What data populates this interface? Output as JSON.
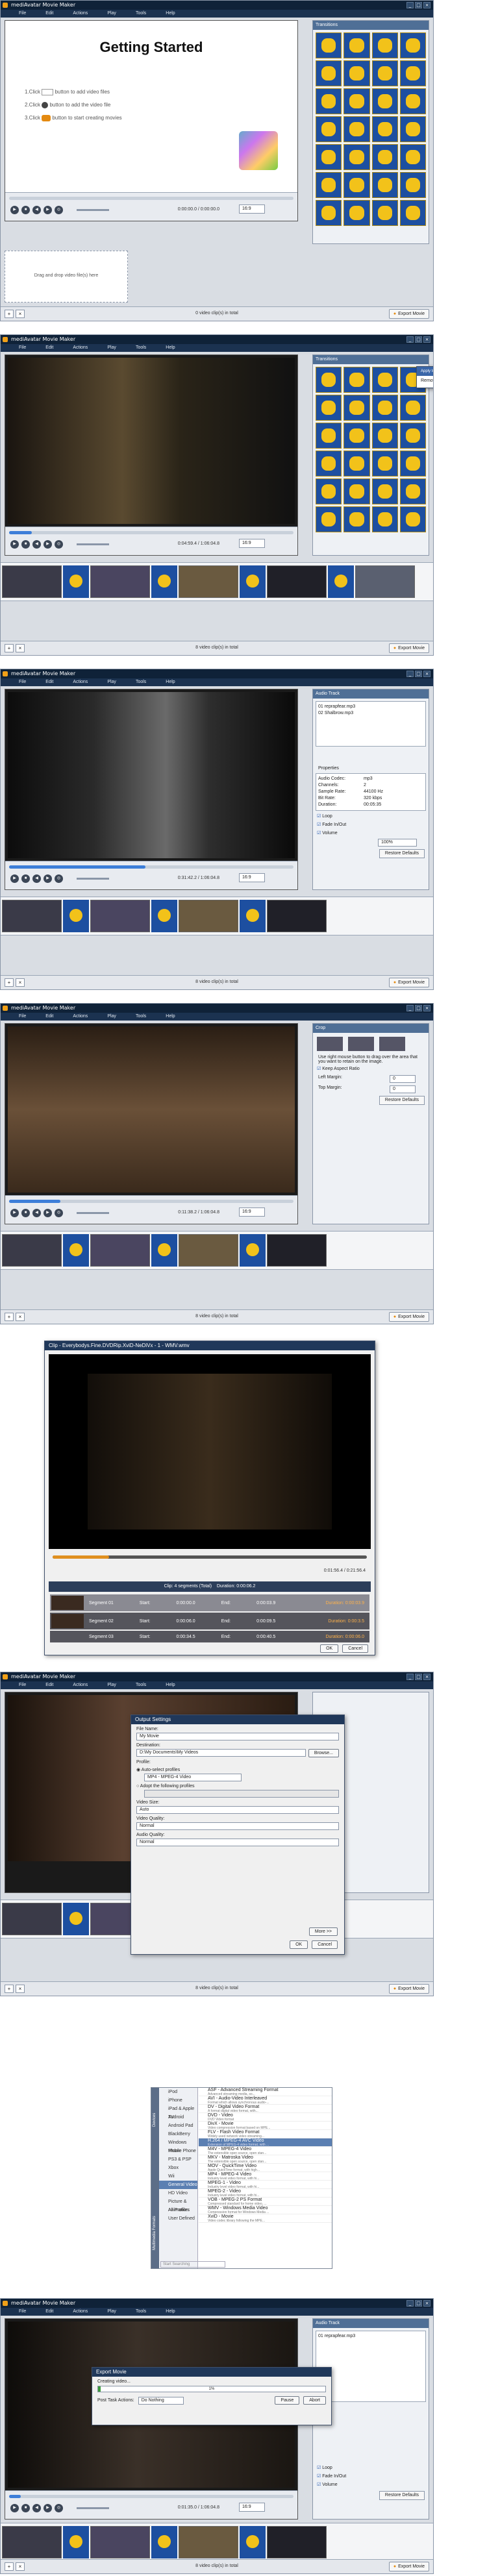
{
  "app": {
    "title": "mediAvatar Movie Maker",
    "menu": [
      "File",
      "Edit",
      "Actions",
      "Play",
      "Tools",
      "Help"
    ]
  },
  "shot1": {
    "heading": "Getting Started",
    "steps": [
      "1.Click",
      "button to add video files",
      "2.Click",
      "button to add the video file",
      "3.Click",
      "button to start creating movies"
    ],
    "dropzone": "Drag and drop video file(s) here",
    "time": "0:00:00.0 / 0:00:00.0",
    "ratio": "16:9",
    "panel_title": "Transitions",
    "status": "0 video clip(s) in total",
    "export": "Export Movie"
  },
  "shot2": {
    "time": "0:04:59.4 / 1:06:04.8",
    "ratio": "16:9",
    "panel_title": "Transitions",
    "ctx_menu": [
      "Apply to Multiple Video Clip(s)",
      "Remove all transitions"
    ],
    "status": "8 video clip(s) in total",
    "export": "Export Movie",
    "seek": 0.08
  },
  "shot3": {
    "panel_title": "Audio Track",
    "tracks": [
      "01 reprapfear.mp3",
      "02 Shalbrow.mp3"
    ],
    "props_title": "Properties",
    "props": [
      [
        "Audio Codec:",
        "mp3"
      ],
      [
        "Channels:",
        "2"
      ],
      [
        "Sample Rate:",
        "44100 Hz"
      ],
      [
        "Bit Rate:",
        "320 kbps"
      ],
      [
        "Duration:",
        "00:05:35"
      ]
    ],
    "checks": [
      "Loop",
      "Fade In/Out",
      "Volume"
    ],
    "volume": "100%",
    "restore": "Restore Defaults",
    "time": "0:31:42.2 / 1:06:04.8",
    "ratio": "16:9",
    "status": "8 video clip(s) in total",
    "export": "Export Movie",
    "seek": 0.48
  },
  "shot4": {
    "panel_title": "Crop",
    "hint": "Use right mouse button to drag over the area that you want to retain on the image.",
    "keep": "Keep Aspect Ratio",
    "left_margin": "Left Margin:",
    "left_val": "0",
    "top_margin": "Top Margin:",
    "top_val": "0",
    "restore": "Restore Defaults",
    "time": "0:11:38.2 / 1:06:04.8",
    "ratio": "16:9",
    "status": "8 video clip(s) in total",
    "export": "Export Movie",
    "seek": 0.18
  },
  "shot5": {
    "title": "Clip - Everybodys.Fine.DVDRip.XviD-NeDiVx - 1 - WMV.wmv",
    "time": "0:01:56.4 / 0:21:56.4",
    "clips_info": "Clip: 4 segments (Total)",
    "duration": "Duration: 0:00:06.2",
    "segments": [
      {
        "name": "Segment 01",
        "start": "0:00:00.0",
        "end": "0:00:03.9",
        "dur": "Duration: 0:00:03.9"
      },
      {
        "name": "Segment 02",
        "start": "0:00:06.0",
        "end": "0:00:09.5",
        "dur": "Duration: 0:00:3.5"
      },
      {
        "name": "Segment 03",
        "start": "0:00:34.5",
        "end": "0:00:40.5",
        "dur": "Duration: 0:00:06.0"
      }
    ],
    "start_label": "Start:",
    "end_label": "End:",
    "ok": "OK",
    "cancel": "Cancel"
  },
  "shot6": {
    "dialog_title": "Output Settings",
    "file_name_label": "File Name:",
    "file_name": "My Movie",
    "dest_label": "Destination:",
    "dest": "D:\\My Documents\\My Videos",
    "browse": "Browse...",
    "profile_label": "Profile:",
    "auto_profile": "Auto-select profiles",
    "auto_value": "MP4 - MPEG-4 Video",
    "adopt": "Adopt the following profiles",
    "video_size_label": "Video Size:",
    "video_size": "Auto",
    "video_quality_label": "Video Quality:",
    "video_quality": "Normal",
    "audio_quality_label": "Audio Quality:",
    "audio_quality": "Normal",
    "more": "More >>",
    "ok": "OK",
    "cancel": "Cancel",
    "status": "8 video clip(s) in total",
    "export": "Export Movie"
  },
  "shot7": {
    "side_labels": [
      "Devices",
      "Multimedia Formats"
    ],
    "categories": [
      "iPod",
      "iPhone",
      "iPad & Apple TV",
      "Android",
      "Android Pad",
      "BlackBerry",
      "Windows Phone",
      "Mobile Phone",
      "PS3 & PSP",
      "Xbox",
      "Wii",
      "General Video Formats",
      "HD Video",
      "Picture & Animation",
      "All Profiles",
      "User Defined"
    ],
    "cat_selected": 11,
    "formats": [
      [
        "ASF - Advanced Streaming Format",
        "Advanced streaming media, so..."
      ],
      [
        "AVI - Audio-Video Interleaved",
        "Format which allows synchronous audio-..."
      ],
      [
        "DV - Digital Video Format",
        "A format digital video format, with..."
      ],
      [
        "DVD - Video",
        "DVD Video format"
      ],
      [
        "DivX - Movie",
        "Video compression format based on MPE..."
      ],
      [
        "FLV - Flash Video Format",
        "Widely used network video streaming..."
      ],
      [
        "H.264 / MPEG-4 AVC Video",
        "Extension of MPEG-4 video format, with ..."
      ],
      [
        "M4V - MPEG-4 Video",
        "The extensible open source, open stan..."
      ],
      [
        "MKV - Matroska Video",
        "The extensible open source, open stan..."
      ],
      [
        "MOV - QuickTime Video",
        "Apple QuickTime format, with high..."
      ],
      [
        "MP4 - MPEG-4 Video",
        "Industry level video format, with hi..."
      ],
      [
        "MPEG-1 - Video",
        "Industry level video format, with hi..."
      ],
      [
        "MPEG-2 - Video",
        "Industry level video format, with hi..."
      ],
      [
        "VOB - MPEG-2 PS Format",
        "Compressed standard for home video, ..."
      ],
      [
        "WMV - Windows Media Video",
        "Compression format for Windows Media ..."
      ],
      [
        "XviD - Movie",
        "Video codec library following the MPE..."
      ]
    ],
    "fmt_selected": 6,
    "search": "Start Searching"
  },
  "shot8": {
    "panel_title": "Audio Track",
    "tracks": [
      "01 reprapfear.mp3"
    ],
    "checks": [
      "Loop",
      "Fade In/Out",
      "Volume"
    ],
    "volume": "100%",
    "restore": "Restore Defaults",
    "dialog_title": "Export Movie",
    "creating": "Creating video...",
    "progress_text": "1%",
    "progress": 0.01,
    "post_label": "Post Task Actions:",
    "post_value": "Do Nothing",
    "pause": "Pause",
    "abort": "Abort",
    "time": "0:01:35.0 / 1:06:04.8",
    "ratio": "16:9",
    "status": "8 video clip(s) in total",
    "export": "Export Movie",
    "seek": 0.04
  }
}
